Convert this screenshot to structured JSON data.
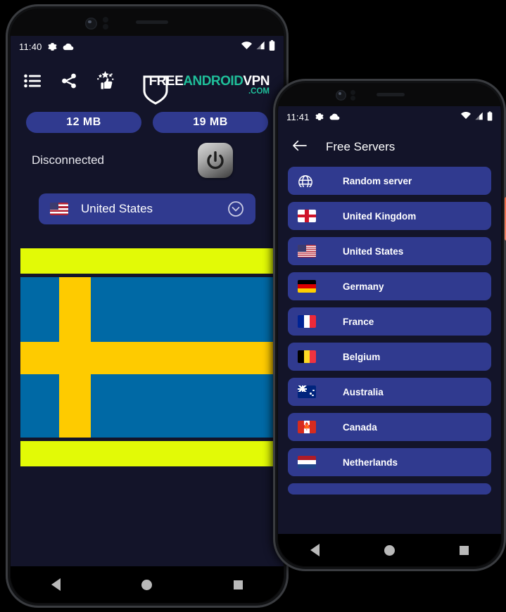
{
  "colors": {
    "screen_bg": "#131429",
    "accent_blue": "#303a8f",
    "logo_teal": "#1fbf9a",
    "band_yellow": "#e2fa06",
    "flag_blue": "#0069a5",
    "flag_gold": "#fecb00",
    "side_key": "#e9633f"
  },
  "phone_left": {
    "status": {
      "time": "11:40",
      "icons": [
        "gear-icon",
        "cloud-icon",
        "wifi-icon",
        "signal-icon",
        "battery-icon"
      ]
    },
    "toolbar": {
      "icons": [
        "list-icon",
        "share-icon",
        "rate-thumbs-up-icon"
      ],
      "logo": {
        "part1": "FREE",
        "part2": "ANDROID",
        "part3": "VPN",
        "domain": ".COM"
      }
    },
    "pills": [
      {
        "label": "12 MB"
      },
      {
        "label": "19 MB"
      }
    ],
    "connection": {
      "status_text": "Disconnected",
      "power_button": "power-icon"
    },
    "country_selector": {
      "flag": "us",
      "name": "United States",
      "chevron": "chevron-down-icon"
    },
    "banner_flag": "sweden",
    "navbar": [
      "back-icon",
      "home-icon",
      "recents-icon"
    ]
  },
  "phone_right": {
    "status": {
      "time": "11:41",
      "icons": [
        "gear-icon",
        "cloud-icon",
        "wifi-icon",
        "signal-icon",
        "battery-icon"
      ]
    },
    "appbar": {
      "back": "back-arrow-icon",
      "title": "Free Servers"
    },
    "servers": [
      {
        "flag": "globe",
        "name": "Random server"
      },
      {
        "flag": "uk",
        "name": "United Kingdom"
      },
      {
        "flag": "us",
        "name": "United States"
      },
      {
        "flag": "de",
        "name": "Germany"
      },
      {
        "flag": "fr",
        "name": "France"
      },
      {
        "flag": "be",
        "name": "Belgium"
      },
      {
        "flag": "au",
        "name": "Australia"
      },
      {
        "flag": "ca",
        "name": "Canada"
      },
      {
        "flag": "nl",
        "name": "Netherlands"
      }
    ],
    "navbar": [
      "back-icon",
      "home-icon",
      "recents-icon"
    ]
  }
}
